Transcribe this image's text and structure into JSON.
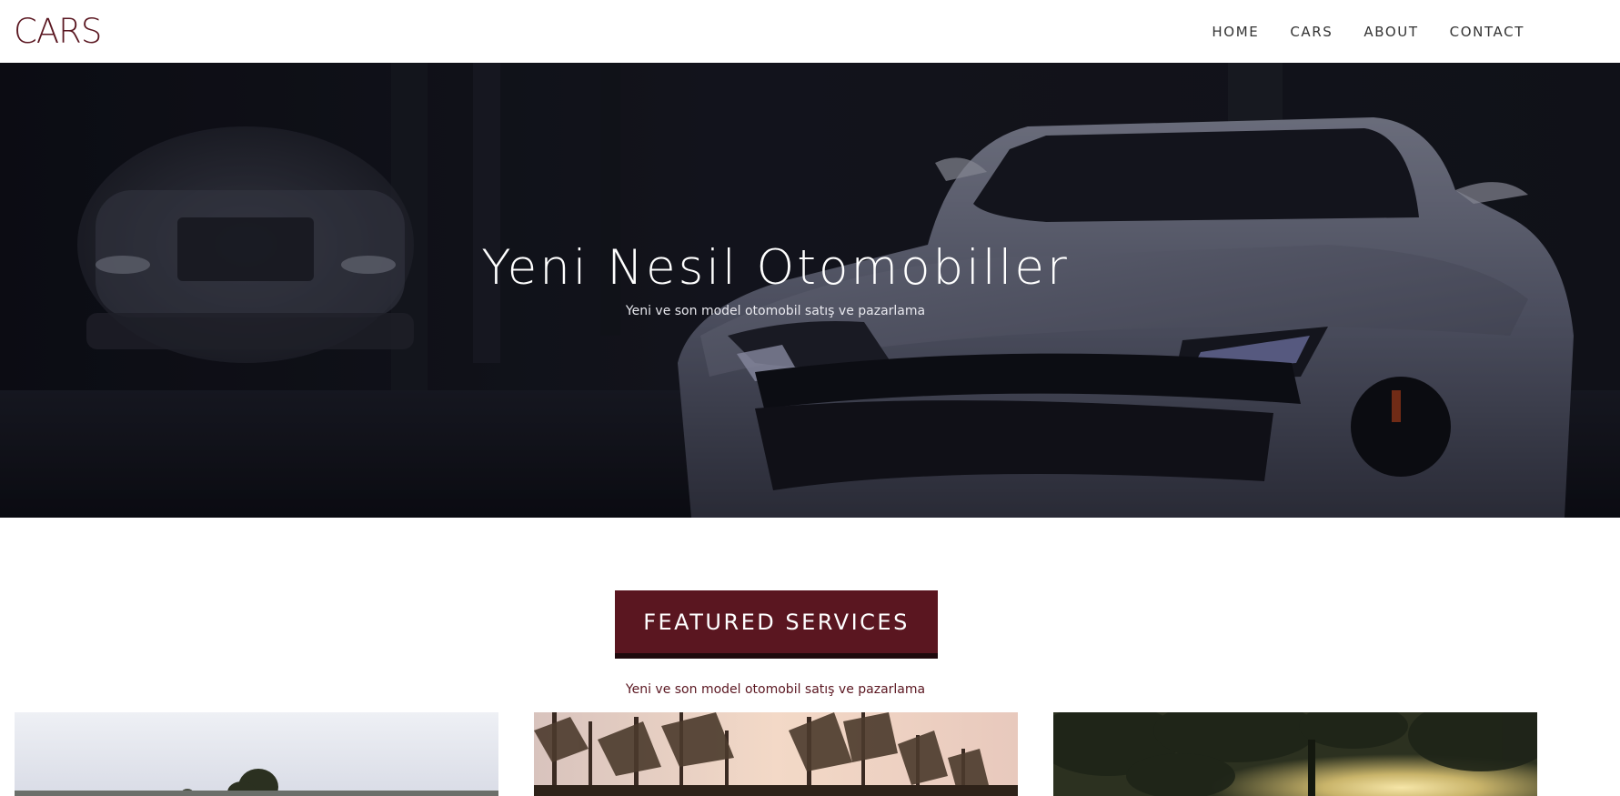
{
  "navbar": {
    "logo": "CARS",
    "links": [
      "HOME",
      "CARS",
      "ABOUT",
      "CONTACT"
    ]
  },
  "hero": {
    "title": "Yeni Nesil Otomobiller",
    "subtitle": "Yeni ve son model otomobil satış ve pazarlama"
  },
  "featured": {
    "heading": "FEATURED SERVICES",
    "subtitle": "Yeni ve son model otomobil satış ve pazarlama"
  },
  "colors": {
    "brand": "#5a1620",
    "brand_dark": "#1f0a0d",
    "nav_text": "#333333"
  },
  "icons": {
    "hero_image": "car-photo",
    "card_images": [
      "road-photo",
      "forest-photo",
      "sunset-trees-photo"
    ]
  }
}
